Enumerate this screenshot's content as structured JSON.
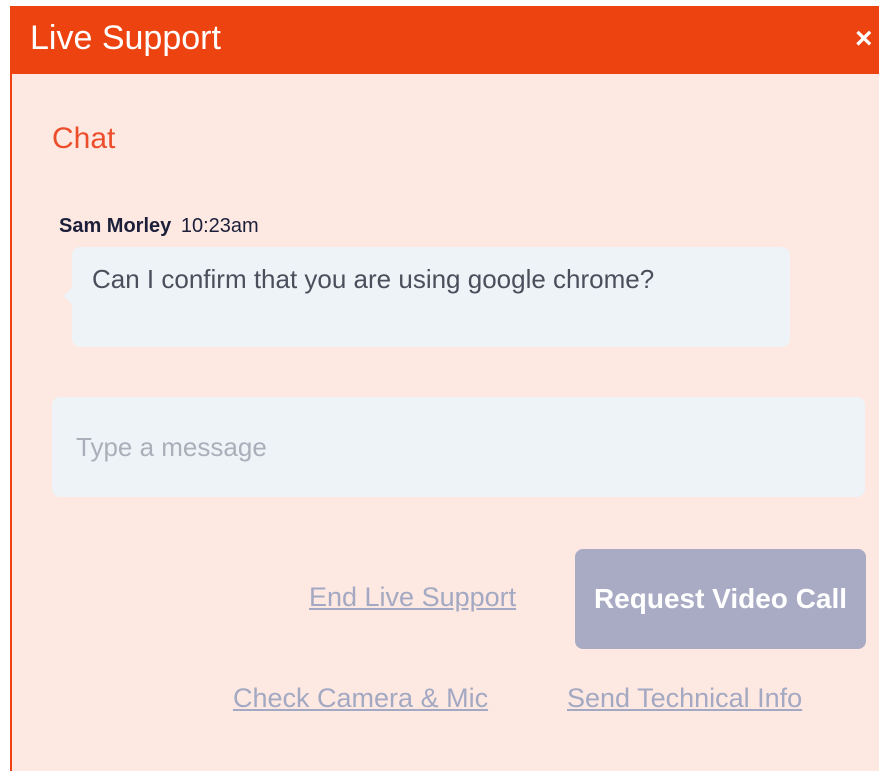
{
  "header": {
    "title": "Live Support",
    "close_glyph": "×"
  },
  "chat": {
    "section_title": "Chat",
    "messages": [
      {
        "author": "Sam Morley",
        "time": "10:23am",
        "text": "Can I confirm that you are using google chrome?"
      }
    ]
  },
  "composer": {
    "placeholder": "Type a message",
    "value": ""
  },
  "actions": {
    "end_support_label": "End Live Support",
    "request_video_label": "Request Video Call",
    "check_camera_label": "Check Camera & Mic",
    "send_tech_info_label": "Send Technical Info"
  },
  "colors": {
    "brand": "#ec4311",
    "panel_bg": "#fde8e2",
    "bubble_bg": "#eef3f7",
    "button_disabled": "#a8abc3",
    "link": "#a3a9c2"
  }
}
